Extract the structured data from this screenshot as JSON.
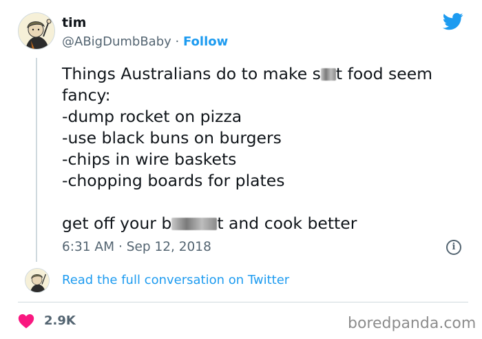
{
  "author": {
    "name": "tim",
    "handle": "@ABigDumbBaby",
    "separator": "·",
    "follow_label": "Follow"
  },
  "tweet": {
    "line1_before": "Things Australians do to make s",
    "line1_after": "t food seem",
    "line2": "fancy:",
    "line3": "-dump rocket on pizza",
    "line4": "-use black buns on burgers",
    "line5": "-chips in wire baskets",
    "line6": "-chopping boards for plates",
    "line7_before": "get off your b",
    "line7_after": "t and cook better"
  },
  "timestamp": {
    "time": "6:31 AM",
    "separator": "·",
    "date": "Sep 12, 2018"
  },
  "info_icon": "i",
  "read_conversation_label": "Read the full conversation on Twitter",
  "likes": {
    "count": "2.9K",
    "icon": "heart-icon",
    "color": "#f91880"
  },
  "watermark": "boredpanda.com",
  "colors": {
    "accent": "#1d9bf0",
    "secondary_text": "#536471",
    "divider": "#cfd9de"
  }
}
